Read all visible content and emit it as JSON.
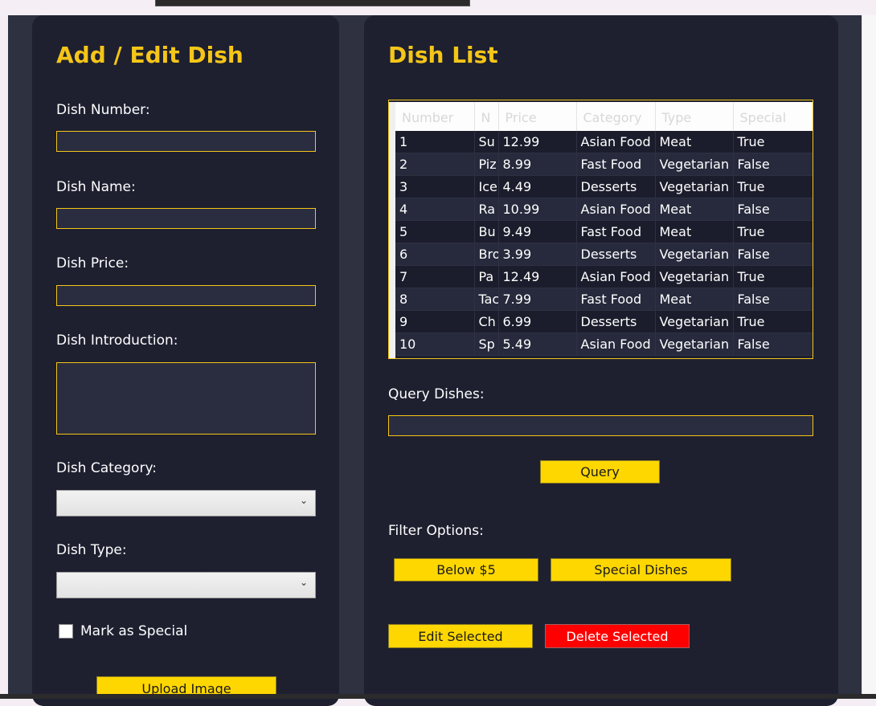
{
  "left_panel": {
    "title": "Add / Edit Dish",
    "dish_number_label": "Dish Number:",
    "dish_number_value": "",
    "dish_name_label": "Dish Name:",
    "dish_name_value": "",
    "dish_price_label": "Dish Price:",
    "dish_price_value": "",
    "dish_intro_label": "Dish Introduction:",
    "dish_intro_value": "",
    "dish_category_label": "Dish Category:",
    "dish_category_value": "",
    "dish_type_label": "Dish Type:",
    "dish_type_value": "",
    "special_label": "Mark as Special",
    "special_checked": false,
    "upload_label": "Upload Image"
  },
  "right_panel": {
    "title": "Dish List",
    "table": {
      "columns": [
        "Number",
        "N",
        "Price",
        "Category",
        "Type",
        "Special"
      ],
      "rows": [
        [
          "1",
          "Su",
          "12.99",
          "Asian Food",
          "Meat",
          "True"
        ],
        [
          "2",
          "Piz",
          "8.99",
          "Fast Food",
          "Vegetarian",
          "False"
        ],
        [
          "3",
          "Ice",
          "4.49",
          "Desserts",
          "Vegetarian",
          "True"
        ],
        [
          "4",
          "Ra",
          "10.99",
          "Asian Food",
          "Meat",
          "False"
        ],
        [
          "5",
          "Bu",
          "9.49",
          "Fast Food",
          "Meat",
          "True"
        ],
        [
          "6",
          "Bro",
          "3.99",
          "Desserts",
          "Vegetarian",
          "False"
        ],
        [
          "7",
          "Pa",
          "12.49",
          "Asian Food",
          "Vegetarian",
          "True"
        ],
        [
          "8",
          "Tac",
          "7.99",
          "Fast Food",
          "Meat",
          "False"
        ],
        [
          "9",
          "Ch",
          "6.99",
          "Desserts",
          "Vegetarian",
          "True"
        ],
        [
          "10",
          "Sp",
          "5.49",
          "Asian Food",
          "Vegetarian",
          "False"
        ]
      ]
    },
    "query_label": "Query Dishes:",
    "query_value": "",
    "query_button": "Query",
    "filter_label": "Filter Options:",
    "below5_button": "Below $5",
    "special_button": "Special Dishes",
    "edit_button": "Edit Selected",
    "delete_button": "Delete Selected"
  },
  "colors": {
    "accent": "#f5c518",
    "button_yellow": "#ffd700",
    "danger": "#ff0000",
    "panel_bg": "#1e2030",
    "window_bg": "#2d3140"
  }
}
